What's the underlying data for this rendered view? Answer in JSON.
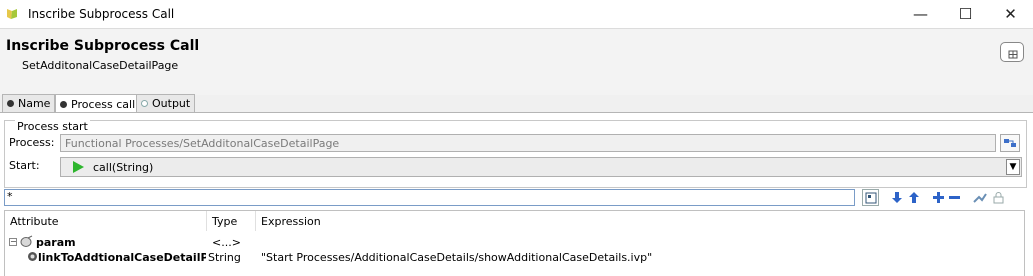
{
  "window": {
    "title": "Inscribe Subprocess Call",
    "minimize": "—",
    "maximize": "☐",
    "close": "✕"
  },
  "header": {
    "title": "Inscribe Subprocess Call",
    "subtitle": "SetAdditonalCaseDetailPage"
  },
  "tabs": [
    {
      "label": "Name",
      "active": false
    },
    {
      "label": "Process call",
      "active": true
    },
    {
      "label": "Output",
      "active": false
    }
  ],
  "process_start": {
    "group_label": "Process start",
    "process_label": "Process:",
    "process_value": "Functional Processes/SetAdditonalCaseDetailPage",
    "start_label": "Start:",
    "start_value": "call(String)"
  },
  "filter": {
    "value": "*"
  },
  "table": {
    "columns": [
      "Attribute",
      "Type",
      "Expression"
    ],
    "rows": [
      {
        "attribute": "param",
        "type": "<...>",
        "expression": ""
      },
      {
        "attribute": "linkToAddtionalCaseDetailPage",
        "type": "String",
        "expression": "\"Start Processes/AdditionalCaseDetails/showAdditionalCaseDetails.ivp\""
      }
    ]
  },
  "colors": {
    "accent": "#2d63c8",
    "play": "#2db52d",
    "window_bg": "#f0f0f0"
  }
}
